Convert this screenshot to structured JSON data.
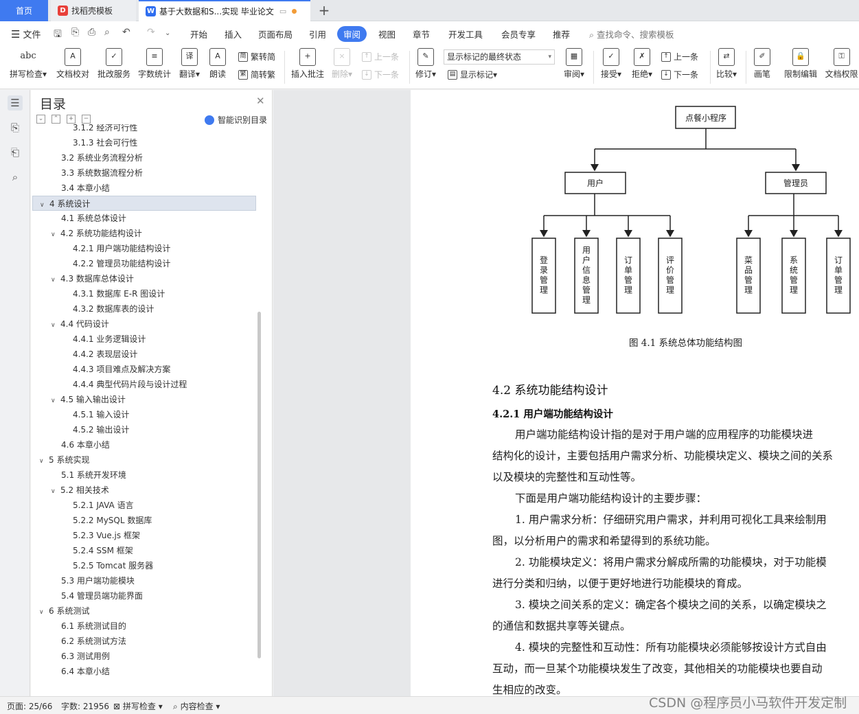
{
  "tabs": {
    "home": "首页",
    "t2": "找稻壳模板",
    "t3": "基于大数据和S...实现 毕业论文",
    "t3_extra": "▭"
  },
  "menu": {
    "file": "文件",
    "items": [
      "开始",
      "插入",
      "页面布局",
      "引用",
      "审阅",
      "视图",
      "章节",
      "开发工具",
      "会员专享",
      "推荐"
    ],
    "search": "查找命令、搜索模板"
  },
  "ribbon": {
    "spell": "拼写检查",
    "doc_check": "文档校对",
    "batch": "批改服务",
    "wordcount": "字数统计",
    "translate": "翻译",
    "read": "朗读",
    "trad": "繁转简",
    "simp": "简转繁",
    "insert_comment": "插入批注",
    "delete": "删除",
    "prev1": "上一条",
    "next1": "下一条",
    "revise": "修订",
    "combo": "显示标记的最终状态",
    "show_marks": "显示标记",
    "review": "审阅",
    "accept": "接受",
    "reject": "拒绝",
    "prev2": "上一条",
    "next2": "下一条",
    "compare": "比较",
    "pen": "画笔",
    "restrict": "限制编辑",
    "perm": "文档权限"
  },
  "toc": {
    "title": "目录",
    "smart": "智能识别目录",
    "items": [
      "3.1.2 经济可行性",
      "3.1.3 社会可行性",
      "3.2 系统业务流程分析",
      "3.3 系统数据流程分析",
      "3.4 本章小结",
      "4 系统设计",
      "4.1 系统总体设计",
      "4.2 系统功能结构设计",
      "4.2.1 用户端功能结构设计",
      "4.2.2 管理员功能结构设计",
      "4.3 数据库总体设计",
      "4.3.1 数据库 E-R 图设计",
      "4.3.2 数据库表的设计",
      "4.4 代码设计",
      "4.4.1 业务逻辑设计",
      "4.4.2 表现层设计",
      "4.4.3 项目难点及解决方案",
      "4.4.4 典型代码片段与设计过程",
      "4.5 输入输出设计",
      "4.5.1 输入设计",
      "4.5.2 输出设计",
      "4.6 本章小结",
      "5 系统实现",
      "5.1 系统开发环境",
      "5.2 相关技术",
      "5.2.1 JAVA 语言",
      "5.2.2 MySQL 数据库",
      "5.2.3 Vue.js 框架",
      "5.2.4 SSM 框架",
      "5.2.5 Tomcat 服务器",
      "5.3 用户端功能模块",
      "5.4 管理员端功能界面",
      "6 系统测试",
      "6.1 系统测试目的",
      "6.2 系统测试方法",
      "6.3 测试用例",
      "6.4 本章小结"
    ]
  },
  "diagram": {
    "root": "点餐小程序",
    "user": "用户",
    "admin": "管理员",
    "user_leaves": [
      "登录管理",
      "用户信息管理",
      "订单管理",
      "评价管理"
    ],
    "admin_leaves": [
      "菜品管理",
      "系统管理",
      "订单管理"
    ]
  },
  "doc": {
    "caption": "图 4.1  系统总体功能结构图",
    "h2": "4.2 系统功能结构设计",
    "h3": "4.2.1 用户端功能结构设计",
    "lines": [
      "用户端功能结构设计指的是对于用户端的应用程序的功能模块进",
      "结构化的设计，主要包括用户需求分析、功能模块定义、模块之间的关系",
      "以及模块的完整性和互动性等。",
      "下面是用户端功能结构设计的主要步骤：",
      "1.  用户需求分析：仔细研究用户需求，并利用可视化工具来绘制用",
      "图，以分析用户的需求和希望得到的系统功能。",
      "2.  功能模块定义：将用户需求分解成所需的功能模块，对于功能模",
      "进行分类和归纳，以便于更好地进行功能模块的育成。",
      "3.  模块之间关系的定义：确定各个模块之间的关系，以确定模块之",
      "的通信和数据共享等关键点。",
      "4.  模块的完整性和互动性：所有功能模块必须能够按设计方式自由",
      "互动，而一旦某个功能模块发生了改变，其他相关的功能模块也要自动",
      "生相应的改变。"
    ]
  },
  "status": {
    "page": "页面: 25/66",
    "words": "字数: 21956",
    "spell": "拼写检查",
    "content": "内容检查"
  },
  "watermark": "CSDN @程序员小马软件开发定制"
}
